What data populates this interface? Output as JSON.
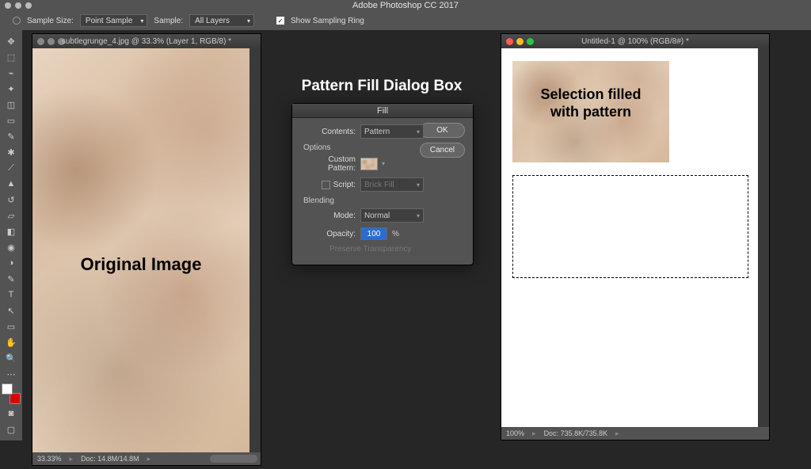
{
  "menubar": {
    "app_title": "Adobe Photoshop CC 2017"
  },
  "options_bar": {
    "sample_size_label": "Sample Size:",
    "sample_size_value": "Point Sample",
    "sample_label": "Sample:",
    "sample_value": "All Layers",
    "show_sampling_ring_label": "Show Sampling Ring"
  },
  "toolbox": [
    "↔",
    "⬚",
    "◧",
    "▱",
    "✎",
    "〰",
    "✶",
    "⟋",
    "◉",
    "✎",
    "T",
    "◇",
    "∿",
    "✋",
    "🔍",
    "⤢",
    ""
  ],
  "doc_left": {
    "title": "subtlegrunge_4.jpg @ 33.3% (Layer 1, RGB/8) *",
    "overlay": "Original Image",
    "zoom": "33.33%",
    "doc_info": "Doc: 14.8M/14.8M"
  },
  "doc_right": {
    "title": "Untitled-1 @ 100% (RGB/8#) *",
    "overlay_l1": "Selection filled",
    "overlay_l2": "with pattern",
    "zoom": "100%",
    "doc_info": "Doc: 735.8K/735.8K"
  },
  "dialog_heading": "Pattern Fill Dialog Box",
  "fill_dialog": {
    "title": "Fill",
    "contents_label": "Contents:",
    "contents_value": "Pattern",
    "ok": "OK",
    "cancel": "Cancel",
    "options_label": "Options",
    "custom_pattern_label": "Custom Pattern:",
    "script_label": "Script:",
    "script_value": "Brick Fill",
    "blending_label": "Blending",
    "mode_label": "Mode:",
    "mode_value": "Normal",
    "opacity_label": "Opacity:",
    "opacity_value": "100",
    "opacity_unit": "%",
    "preserve_transparency_label": "Preserve Transparency"
  }
}
